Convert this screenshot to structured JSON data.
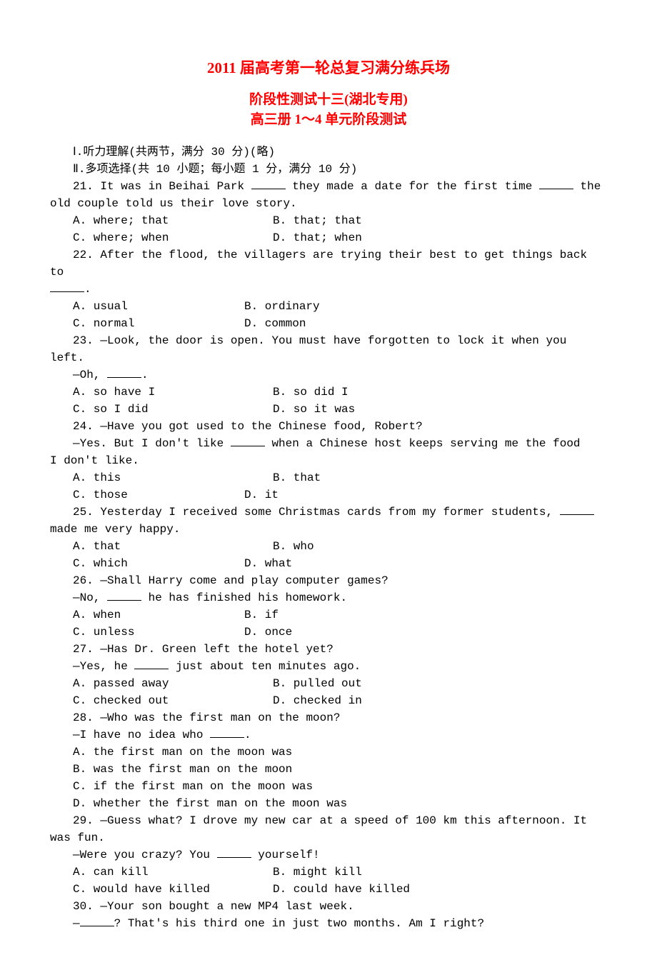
{
  "title_main": "2011 届高考第一轮总复习满分练兵场",
  "title_sub1": "阶段性测试十三(湖北专用)",
  "title_sub2": "高三册 1～4 单元阶段测试",
  "section1": "Ⅰ.听力理解(共两节，满分 30 分)(略)",
  "section2": "Ⅱ.多项选择(共 10 小题；每小题 1 分，满分 10 分)",
  "q21_a": "21. It was in Beihai Park ",
  "q21_b": " they made a date for the first time ",
  "q21_c": " the",
  "q21_cont": "old couple told us their love story.",
  "q21_optA": "A. where; that",
  "q21_optB": "B. that; that",
  "q21_optC": "C. where; when",
  "q21_optD": "D. that; when",
  "q22_a": "22. After the flood, the villagers are trying their best to get things back to",
  "q22_cont": ".",
  "q22_optA": "A. usual",
  "q22_optB": "B. ordinary",
  "q22_optC": "C. normal",
  "q22_optD": "D. common",
  "q23_a": "23. —Look, the door is open. You must have forgotten to lock it when you",
  "q23_cont": "left.",
  "q23_line2_a": "—Oh, ",
  "q23_line2_b": ".",
  "q23_optA": "A. so have I",
  "q23_optB": "B. so did I",
  "q23_optC": "C. so I did",
  "q23_optD": "D. so it was",
  "q24_a": "24. —Have you got used to the Chinese food, Robert?",
  "q24_line2_a": "—Yes. But I don't like ",
  "q24_line2_b": " when a Chinese host keeps serving me the food",
  "q24_cont": "I don't like.",
  "q24_optA": "A. this",
  "q24_optB": "B. that",
  "q24_optC": "C. those",
  "q24_optD": "D. it",
  "q25_a": "25. Yesterday I received some Christmas cards from my  former students, ",
  "q25_cont": "made me very happy.",
  "q25_optA": "A. that",
  "q25_optB": "B. who",
  "q25_optC": "C. which",
  "q25_optD": "D. what",
  "q26_a": "26. —Shall Harry come and play computer games?",
  "q26_line2_a": "—No, ",
  "q26_line2_b": " he has finished his homework.",
  "q26_optA": "A. when",
  "q26_optB": "B. if",
  "q26_optC": "C. unless",
  "q26_optD": "D. once",
  "q27_a": "27. —Has Dr. Green left the hotel yet?",
  "q27_line2_a": "—Yes, he ",
  "q27_line2_b": " just about ten minutes ago.",
  "q27_optA": "A. passed away",
  "q27_optB": "B. pulled out",
  "q27_optC": "C. checked out",
  "q27_optD": "D. checked in",
  "q28_a": "28. —Who was the first man on the moon?",
  "q28_line2_a": "—I have no idea who ",
  "q28_line2_b": ".",
  "q28_optA": "A. the first man on the moon was",
  "q28_optB": "B. was the first man on the moon",
  "q28_optC": "C. if the first man on the moon was",
  "q28_optD": "D. whether the first man on the moon was",
  "q29_a": "29. —Guess what? I drove my new car at a speed of 100 km this afternoon. It",
  "q29_cont": "was fun.",
  "q29_line2_a": "—Were you crazy? You ",
  "q29_line2_b": " yourself!",
  "q29_optA": "A. can kill",
  "q29_optB": "B. might kill",
  "q29_optC": "C. would have killed",
  "q29_optD": "D. could have killed",
  "q30_a": "30. —Your son bought a new MP4 last week.",
  "q30_line2_a": "—",
  "q30_line2_b": "?  That's his third one in just two months. Am I right?"
}
